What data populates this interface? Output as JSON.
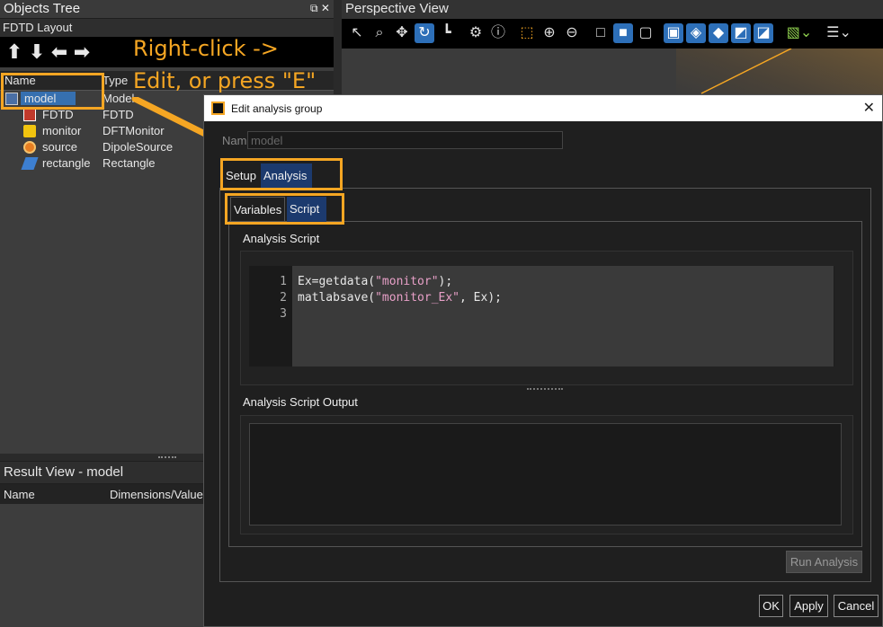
{
  "objects_tree": {
    "title": "Objects Tree",
    "controls": "⧉ ✕",
    "layout_label": "FDTD Layout",
    "nav_arrows": [
      "⬆",
      "⬇",
      "⬅",
      "➡"
    ],
    "columns": {
      "name": "Name",
      "type": "Type"
    },
    "rows": [
      {
        "name": "model",
        "type": "Model",
        "icon": "model-icon",
        "selected": true
      },
      {
        "name": "FDTD",
        "type": "FDTD",
        "icon": "fdtd-icon"
      },
      {
        "name": "monitor",
        "type": "DFTMonitor",
        "icon": "monitor-icon"
      },
      {
        "name": "source",
        "type": "DipoleSource",
        "icon": "source-icon"
      },
      {
        "name": "rectangle",
        "type": "Rectangle",
        "icon": "rectangle-icon"
      }
    ]
  },
  "result_view": {
    "title": "Result View - model",
    "columns": {
      "name": "Name",
      "dimensions": "Dimensions/Value"
    }
  },
  "perspective_view": {
    "title": "Perspective View",
    "toolbar_icons": [
      "pointer-icon",
      "zoom-region-icon",
      "pan-icon",
      "rotate-icon",
      "ruler-icon",
      "gear-icon",
      "help-icon",
      "zoom-extent-icon",
      "zoom-in-icon",
      "zoom-out-icon",
      "wireframe-icon",
      "solid-icon",
      "box-icon",
      "view-1-icon",
      "view-2-icon",
      "view-3-icon",
      "view-4-icon",
      "view-5-icon",
      "cube-dropdown-icon",
      "layout-dropdown-icon"
    ]
  },
  "annotation": {
    "line1": "Right-click ->",
    "line2": "Edit, or press \"E\"",
    "color": "#f5a623"
  },
  "dialog": {
    "title": "Edit analysis group",
    "name_label": "Name",
    "name_value": "model",
    "tabs": [
      "Setup",
      "Analysis"
    ],
    "active_tab": "Analysis",
    "subtabs": [
      "Variables",
      "Script"
    ],
    "active_subtab": "Script",
    "script_label": "Analysis Script",
    "line_numbers": [
      "1",
      "2",
      "3"
    ],
    "script_lines": [
      {
        "pre": "Ex=getdata(",
        "str": "\"monitor\"",
        "post": ");"
      },
      {
        "pre": "matlabsave(",
        "str": "\"monitor_Ex\"",
        "post": ", Ex);"
      },
      {
        "pre": "",
        "str": "",
        "post": ""
      }
    ],
    "output_label": "Analysis Script Output",
    "output_text": "",
    "run_button": "Run Analysis",
    "ok_button": "OK",
    "apply_button": "Apply",
    "cancel_button": "Cancel"
  }
}
